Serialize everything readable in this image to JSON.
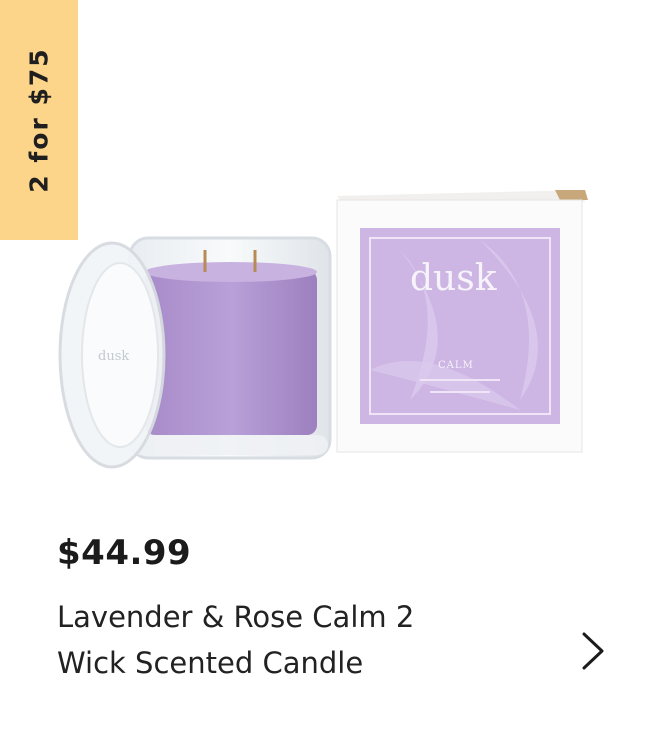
{
  "badge": {
    "text": "2 for $75",
    "color": "#fcd48a"
  },
  "product": {
    "price": "$44.99",
    "title_line1": "Lavender & Rose Calm 2",
    "title_line2": "Wick Scented Candle",
    "image": {
      "box_brand": "dusk",
      "box_name": "CALM",
      "lid_brand": "dusk",
      "candle_color": "#b49ad0",
      "box_color": "#cdb6e3"
    }
  },
  "navigation": {
    "next_icon": "chevron-right-icon"
  }
}
